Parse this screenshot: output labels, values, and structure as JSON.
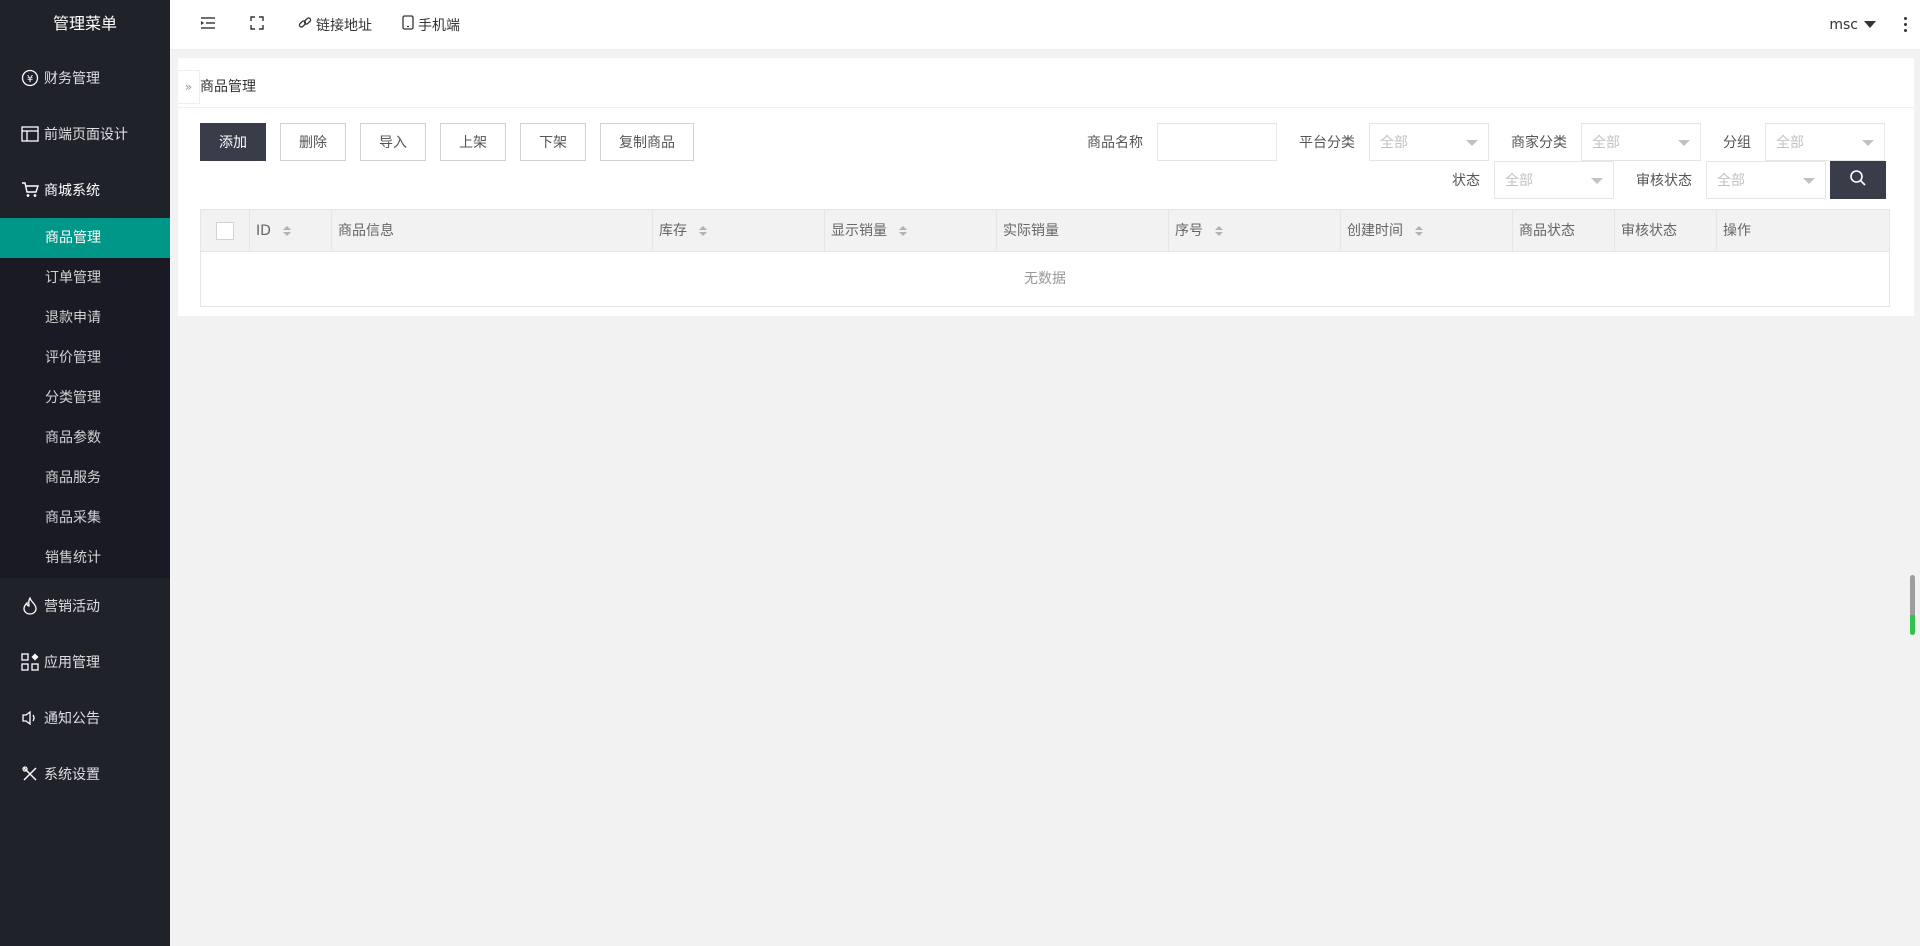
{
  "sidebar": {
    "title": "管理菜单",
    "groups": [
      {
        "label": "财务管理",
        "icon": "yen-icon"
      },
      {
        "label": "前端页面设计",
        "icon": "layout-icon"
      },
      {
        "label": "商城系统",
        "icon": "cart-icon"
      },
      {
        "label": "营销活动",
        "icon": "fire-icon"
      },
      {
        "label": "应用管理",
        "icon": "apps-icon"
      },
      {
        "label": "通知公告",
        "icon": "speaker-icon"
      },
      {
        "label": "系统设置",
        "icon": "tools-icon"
      }
    ],
    "submenu": [
      "商品管理",
      "订单管理",
      "退款申请",
      "评价管理",
      "分类管理",
      "商品参数",
      "商品服务",
      "商品采集",
      "销售统计"
    ],
    "active_item": "商品管理"
  },
  "header": {
    "link_label": "链接地址",
    "mobile_label": "手机端",
    "user": "msc"
  },
  "card": {
    "title": "商品管理",
    "fold_glyph": "»"
  },
  "toolbar": {
    "add": "添加",
    "delete": "删除",
    "import": "导入",
    "shelve": "上架",
    "unshelve": "下架",
    "copy": "复制商品"
  },
  "filters": {
    "name_label": "商品名称",
    "name_value": "",
    "platform_label": "平台分类",
    "platform_value": "全部",
    "merchant_label": "商家分类",
    "merchant_value": "全部",
    "group_label": "分组",
    "group_value": "全部",
    "status_label": "状态",
    "status_value": "全部",
    "audit_label": "审核状态",
    "audit_value": "全部"
  },
  "table": {
    "columns": [
      "ID",
      "商品信息",
      "库存",
      "显示销量",
      "实际销量",
      "序号",
      "创建时间",
      "商品状态",
      "审核状态",
      "操作"
    ],
    "empty_text": "无数据"
  },
  "scroll_indicator": {
    "level": 0.33,
    "fill_color": "#33c24a"
  },
  "colors": {
    "sidebar_bg": "#20222a",
    "active": "#009688",
    "primary_btn": "#393d49"
  }
}
